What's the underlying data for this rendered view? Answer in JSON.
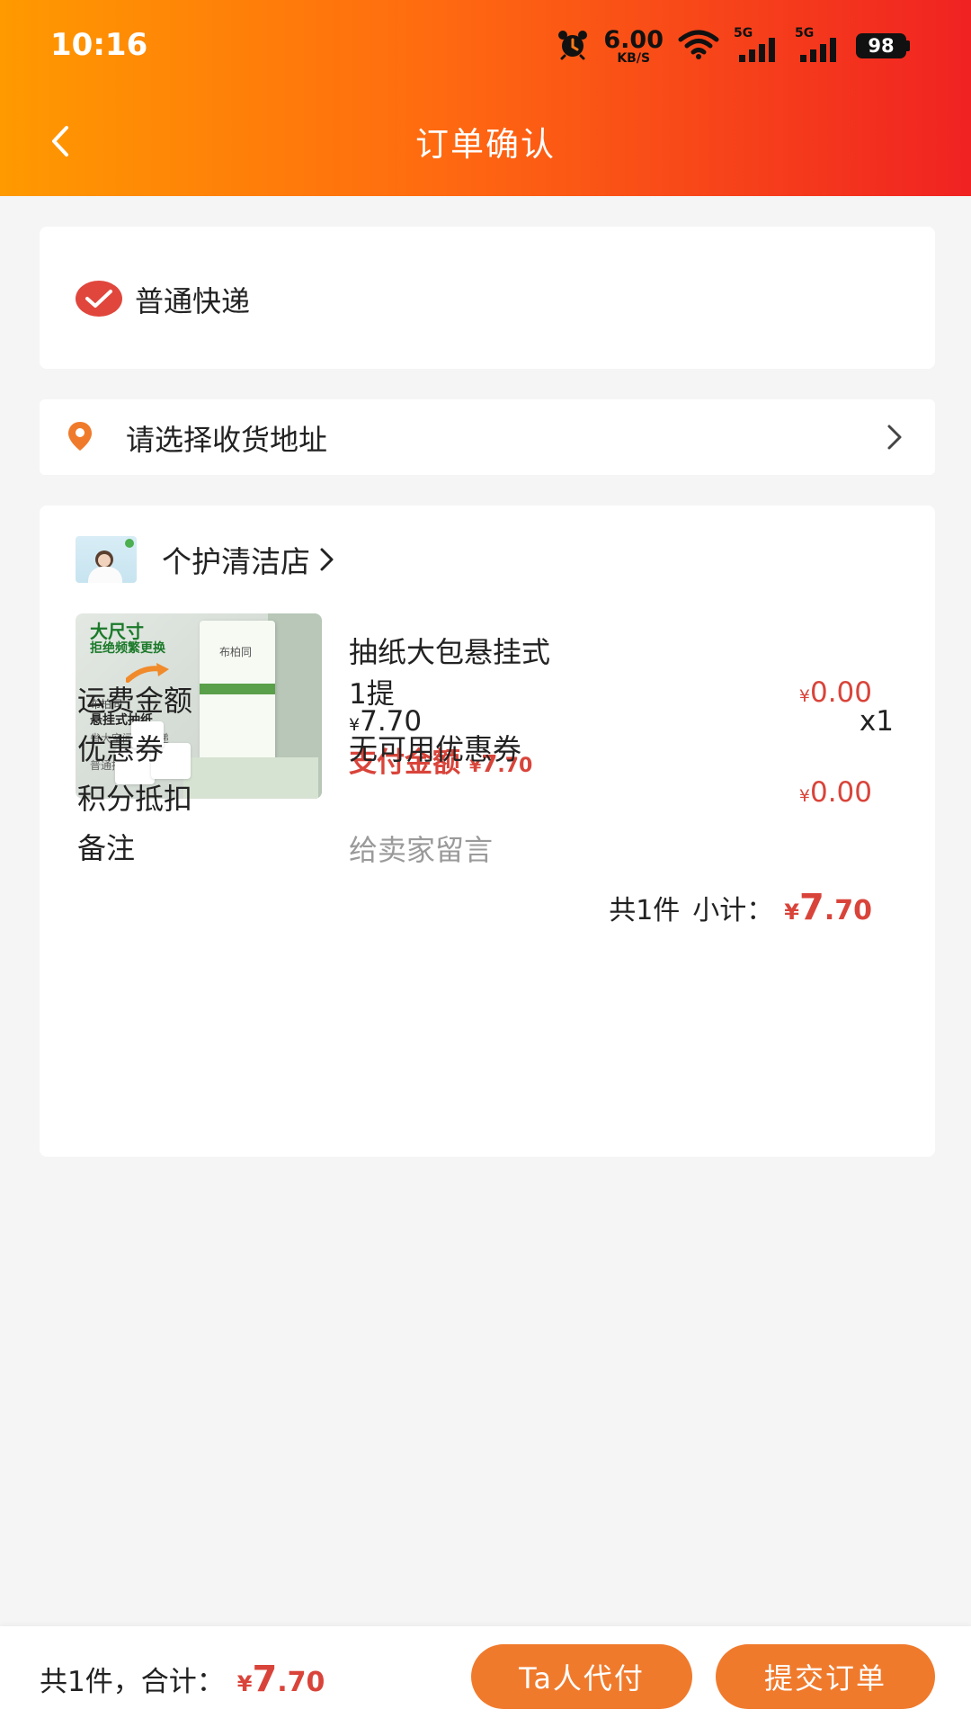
{
  "status_bar": {
    "time": "10:16",
    "net_speed": "6.00",
    "net_unit": "KB/S",
    "sim1": "5G",
    "sim2": "5G",
    "battery": "98"
  },
  "header": {
    "title": "订单确认"
  },
  "shipping": {
    "label": "普通快递",
    "selected": true
  },
  "address": {
    "placeholder": "请选择收货地址"
  },
  "store": {
    "name": "个护清洁店"
  },
  "product": {
    "name": "抽纸大包悬挂式",
    "spec": "1提",
    "price_symbol": "¥",
    "price": "7.70",
    "quantity": "x1",
    "pay_label": "支付金额",
    "pay_symbol": "¥",
    "pay_int": "7",
    "pay_dec": ".70",
    "image_text": {
      "headline": "大尺寸",
      "subline": "拒绝频繁更换",
      "brand_small": "布柏同",
      "feature": "悬挂式抽纸",
      "feature_sub": "省大空间 分层递",
      "normal": "普通抽纸",
      "pack_brand": "布柏同"
    }
  },
  "details": {
    "shipping_fee_label": "运费金额",
    "shipping_fee_symbol": "¥",
    "shipping_fee": "0.00",
    "coupon_label": "优惠券",
    "coupon_value": "无可用优惠券",
    "points_label": "积分抵扣",
    "points_symbol": "¥",
    "points_value": "0.00",
    "note_label": "备注",
    "note_placeholder": "给卖家留言"
  },
  "subtotal": {
    "count_text": "共1件",
    "label": "小计：",
    "symbol": "¥",
    "int": "7",
    "dec": ".70"
  },
  "bottom_bar": {
    "total_text": "共1件，合计：",
    "symbol": "¥",
    "int": "7",
    "dec": ".70",
    "proxy_button": "Ta人代付",
    "submit_button": "提交订单"
  },
  "colors": {
    "header_gradient_start": "#ff9a00",
    "header_gradient_end": "#f02222",
    "price_red": "#d9443a",
    "button_orange": "#f07a2c",
    "check_red": "#e0463c",
    "pin_orange": "#f07a2c"
  },
  "icons": {
    "back": "chevron-left-icon",
    "check": "check-circle-icon",
    "pin": "location-pin-icon",
    "chevron": "chevron-right-icon"
  }
}
